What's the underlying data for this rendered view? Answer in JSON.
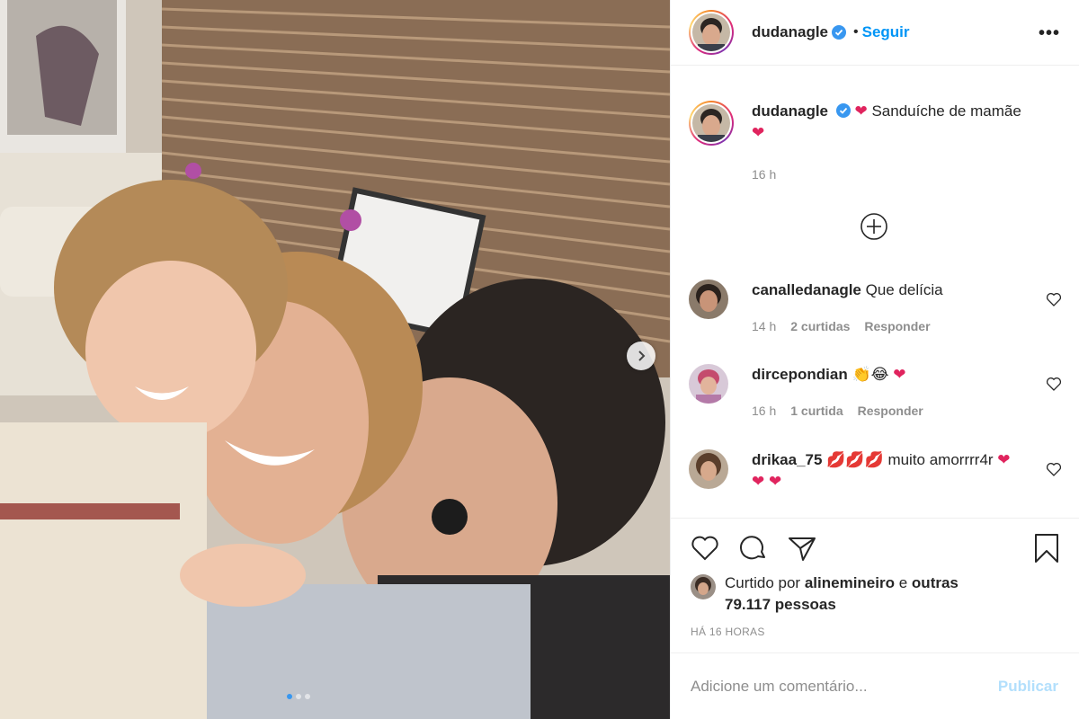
{
  "post": {
    "author": "dudanagle",
    "follow_sep": "•",
    "follow_label": "Seguir",
    "more_label": "•••",
    "caption_text": "Sanduíche de mamãe",
    "caption_time": "16 h",
    "carousel_slides": 3,
    "carousel_active": 1
  },
  "comments": [
    {
      "user": "canalledanagle",
      "text": "Que delícia",
      "time": "14 h",
      "likes": "2 curtidas",
      "reply": "Responder"
    },
    {
      "user": "dircepondian",
      "text": "👏😂",
      "time": "16 h",
      "likes": "1 curtida",
      "reply": "Responder"
    },
    {
      "user": "drikaa_75",
      "text": "muito amorrrr4r"
    }
  ],
  "likes": {
    "prefix": "Curtido por",
    "user": "alinemineiro",
    "conj": "e",
    "others": "outras 79.117 pessoas"
  },
  "timeago": "HÁ 16 HORAS",
  "add_comment": {
    "placeholder": "Adicione um comentário...",
    "publish_label": "Publicar"
  },
  "colors": {
    "accent": "#0095f6",
    "publish_disabled": "#b2dffc",
    "muted": "#8e8e8e",
    "heart": "#ed4956",
    "verified": "#3897f0"
  },
  "icons": [
    "verified-icon",
    "more-icon",
    "load-more-icon",
    "heart-icon",
    "comment-icon",
    "share-icon",
    "bookmark-icon",
    "next-icon"
  ]
}
